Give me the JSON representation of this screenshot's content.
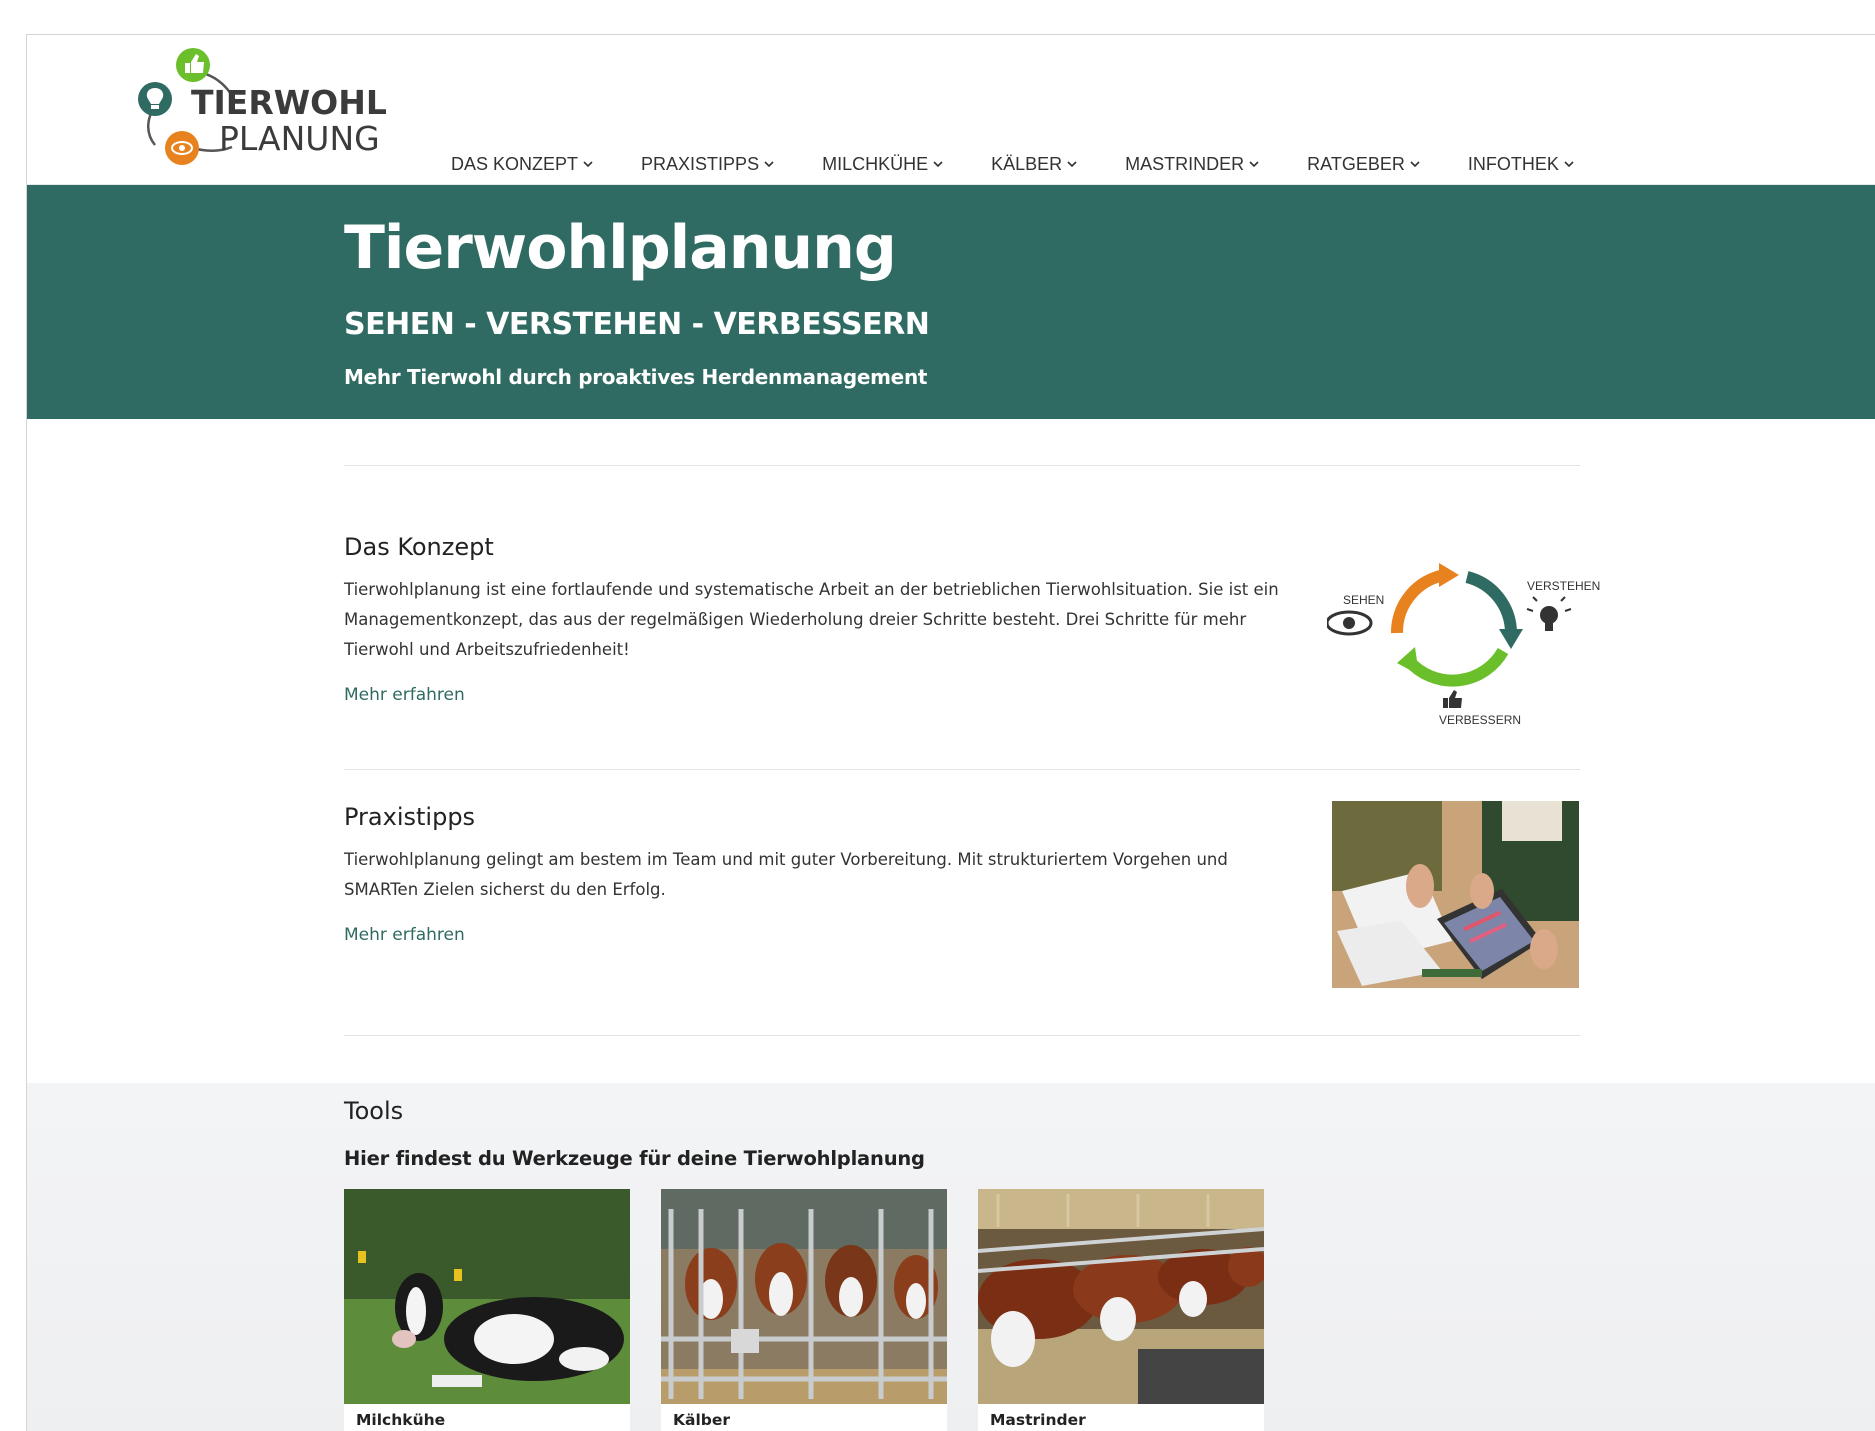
{
  "brand": {
    "line1": "TIERWOHL",
    "line2": "PLANUNG",
    "colors": {
      "green": "#6abf2a",
      "orange": "#e8821e",
      "teal": "#2f6b62"
    }
  },
  "nav": {
    "items": [
      {
        "label": "DAS KONZEPT"
      },
      {
        "label": "PRAXISTIPPS"
      },
      {
        "label": "MILCHKÜHE"
      },
      {
        "label": "KÄLBER"
      },
      {
        "label": "MASTRINDER"
      },
      {
        "label": "RATGEBER"
      },
      {
        "label": "INFOTHEK"
      }
    ]
  },
  "hero": {
    "title": "Tierwohlplanung",
    "subtitle": "SEHEN - VERSTEHEN - VERBESSERN",
    "tagline": "Mehr Tierwohl durch proaktives Herdenmanagement",
    "bg_color": "#2f6b62"
  },
  "konzept": {
    "title": "Das Konzept",
    "text": "Tierwohlplanung ist eine fortlaufende und systematische Arbeit an der betrieblichen Tierwohlsituation. Sie ist ein Managementkonzept, das aus der regelmäßigen Wiederholung dreier Schritte besteht. Drei Schritte für mehr Tierwohl und Arbeitszufriedenheit!",
    "link": "Mehr erfahren",
    "diagram": {
      "sehen": "SEHEN",
      "verstehen": "VERSTEHEN",
      "verbessern": "VERBESSERN"
    }
  },
  "praxistipps": {
    "title": "Praxistipps",
    "text": "Tierwohlplanung gelingt am bestem im Team und mit guter Vorbereitung. Mit strukturiertem Vorgehen und SMARTen Zielen sicherst du den Erfolg.",
    "link": "Mehr erfahren"
  },
  "tools": {
    "title": "Tools",
    "subtitle": "Hier findest du Werkzeuge für deine Tierwohlplanung",
    "cards": [
      {
        "label": "Milchkühe"
      },
      {
        "label": "Kälber"
      },
      {
        "label": "Mastrinder"
      }
    ]
  }
}
